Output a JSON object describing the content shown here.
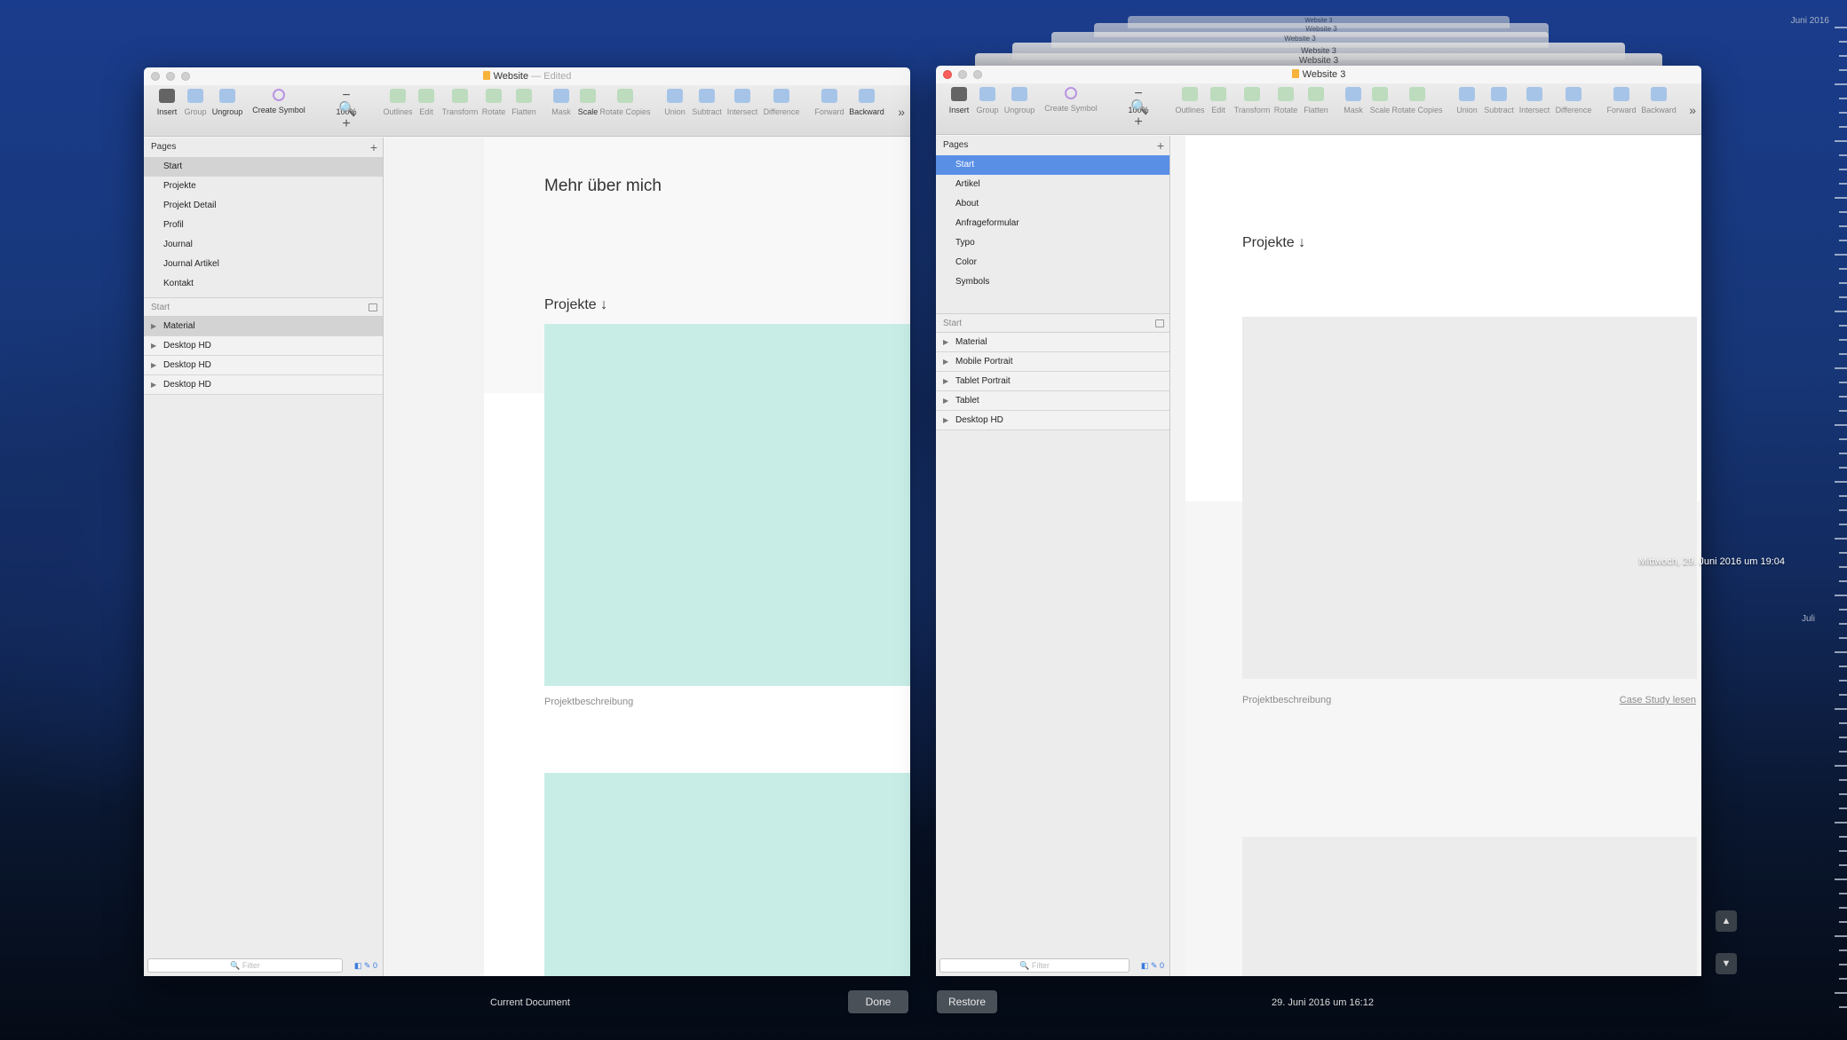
{
  "left_window": {
    "title": "Website",
    "title_suffix": "— Edited",
    "toolbar": [
      {
        "label": "Insert"
      },
      {
        "label": "Group"
      },
      {
        "label": "Ungroup"
      },
      {
        "label": "Create Symbol"
      },
      {
        "label": "100%"
      },
      {
        "label": "Outlines"
      },
      {
        "label": "Edit"
      },
      {
        "label": "Transform"
      },
      {
        "label": "Rotate"
      },
      {
        "label": "Flatten"
      },
      {
        "label": "Mask"
      },
      {
        "label": "Scale"
      },
      {
        "label": "Rotate Copies"
      },
      {
        "label": "Union"
      },
      {
        "label": "Subtract"
      },
      {
        "label": "Intersect"
      },
      {
        "label": "Difference"
      },
      {
        "label": "Forward"
      },
      {
        "label": "Backward"
      }
    ],
    "pages_header": "Pages",
    "pages": [
      "Start",
      "Projekte",
      "Projekt Detail",
      "Profil",
      "Journal",
      "Journal Artikel",
      "Kontakt"
    ],
    "layers_header": "Start",
    "layers": [
      "Material",
      "Desktop HD",
      "Desktop HD",
      "Desktop HD"
    ],
    "filter_placeholder": "Filter",
    "filter_count": "0",
    "canvas": {
      "heading": "Mehr über mich",
      "section": "Projekte ↓",
      "caption": "Projektbeschreibung"
    }
  },
  "right_window": {
    "title": "Website 3",
    "stacked_titles": [
      "Website 3",
      "Website 3",
      "Website 3",
      "Website 3",
      "Website 3"
    ],
    "toolbar": [
      {
        "label": "Insert"
      },
      {
        "label": "Group"
      },
      {
        "label": "Ungroup"
      },
      {
        "label": "Create Symbol"
      },
      {
        "label": "100%"
      },
      {
        "label": "Outlines"
      },
      {
        "label": "Edit"
      },
      {
        "label": "Transform"
      },
      {
        "label": "Rotate"
      },
      {
        "label": "Flatten"
      },
      {
        "label": "Mask"
      },
      {
        "label": "Scale"
      },
      {
        "label": "Rotate Copies"
      },
      {
        "label": "Union"
      },
      {
        "label": "Subtract"
      },
      {
        "label": "Intersect"
      },
      {
        "label": "Difference"
      },
      {
        "label": "Forward"
      },
      {
        "label": "Backward"
      }
    ],
    "pages_header": "Pages",
    "pages": [
      "Start",
      "Artikel",
      "About",
      "Anfrageformular",
      "Typo",
      "Color",
      "Symbols"
    ],
    "layers_header": "Start",
    "layers": [
      "Material",
      "Mobile Portrait",
      "Tablet Portrait",
      "Tablet",
      "Desktop HD"
    ],
    "filter_placeholder": "Filter",
    "filter_count": "0",
    "canvas": {
      "section": "Projekte ↓",
      "caption": "Projektbeschreibung",
      "link": "Case Study lesen"
    }
  },
  "bottom": {
    "current_label": "Current Document",
    "done_label": "Done",
    "restore_label": "Restore",
    "version_date": "29. Juni 2016 um 16:12"
  },
  "timeline": {
    "top_label": "Juni 2016",
    "mid_label": "Juli",
    "selected_date": "Mittwoch, 29. Juni 2016 um 19:04",
    "up_icon": "chevron-up-icon",
    "down_icon": "chevron-down-icon"
  }
}
